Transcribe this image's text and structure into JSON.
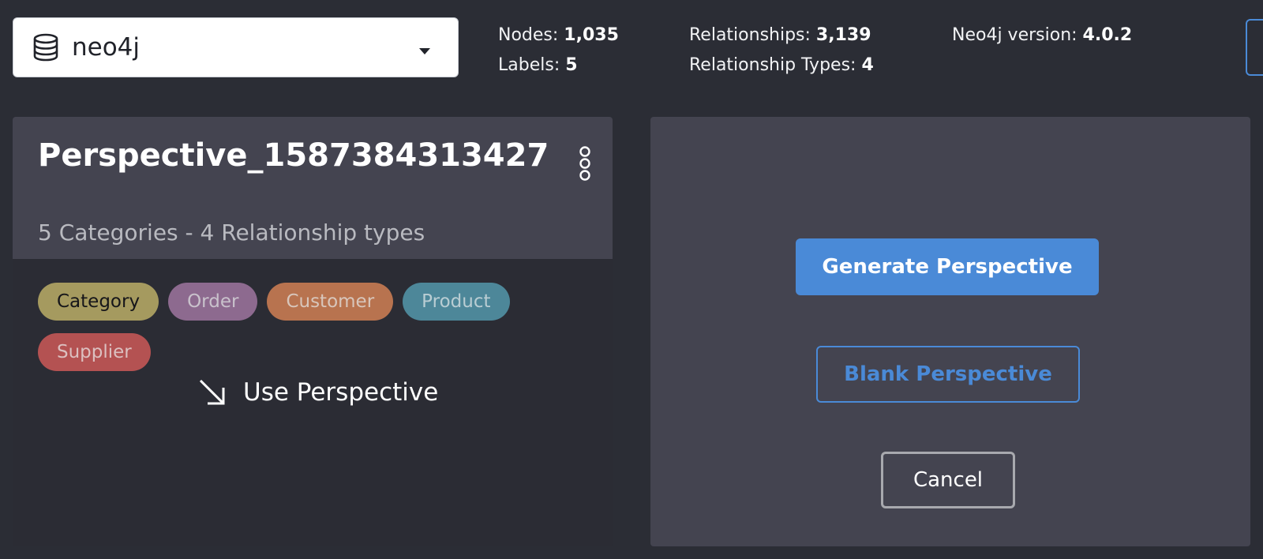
{
  "database": {
    "name": "neo4j",
    "icon": "database-icon",
    "dropdown_icon": "caret-down-icon"
  },
  "stats": {
    "nodes_label": "Nodes: ",
    "nodes_value": "1,035",
    "labels_label": "Labels: ",
    "labels_value": "5",
    "relationships_label": "Relationships: ",
    "relationships_value": "3,139",
    "rel_types_label": "Relationship Types: ",
    "rel_types_value": "4",
    "version_label": "Neo4j version: ",
    "version_value": "4.0.2"
  },
  "perspective": {
    "title": "Perspective_1587384313427",
    "subtitle": "5 Categories - 4 Relationship types",
    "menu_icon": "kebab-menu-icon",
    "categories": [
      {
        "label": "Category",
        "bg": "#a59a5f",
        "fg": "#16161a"
      },
      {
        "label": "Order",
        "bg": "#8d6a8f",
        "fg": "#c9c2cc"
      },
      {
        "label": "Customer",
        "bg": "#b8734f",
        "fg": "#d8c6bb"
      },
      {
        "label": "Product",
        "bg": "#4d8799",
        "fg": "#b9cdd3"
      },
      {
        "label": "Supplier",
        "bg": "#b45252",
        "fg": "#dcc0c0"
      }
    ],
    "use_label": "Use Perspective",
    "use_icon": "arrow-down-right-icon"
  },
  "actions": {
    "generate_label": "Generate Perspective",
    "blank_label": "Blank Perspective",
    "cancel_label": "Cancel"
  },
  "colors": {
    "accent": "#4a8ad7",
    "background": "#2b2d35",
    "panel": "#444450"
  }
}
